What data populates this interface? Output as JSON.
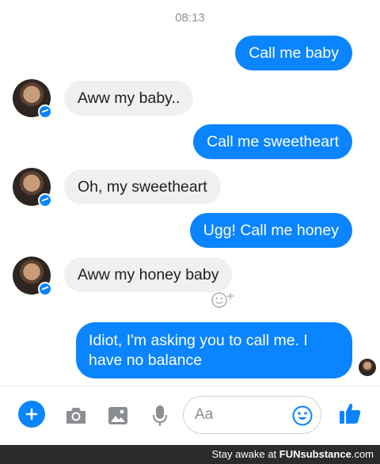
{
  "header": {
    "timestamp": "08:13"
  },
  "messages": [
    {
      "from": "me",
      "text": "Call me baby"
    },
    {
      "from": "contact",
      "text": "Aww my baby.."
    },
    {
      "from": "me",
      "text": "Call me sweetheart"
    },
    {
      "from": "contact",
      "text": "Oh, my sweetheart"
    },
    {
      "from": "me",
      "text": "Ugg! Call me honey"
    },
    {
      "from": "contact",
      "text": "Aww my honey baby"
    },
    {
      "from": "me",
      "text": "Idiot, I'm asking you to call me. I have no balance"
    }
  ],
  "composer": {
    "placeholder": "Aa",
    "icons": [
      "plus-icon",
      "camera-icon",
      "image-icon",
      "microphone-icon",
      "emoji-icon",
      "thumbs-up-icon"
    ]
  },
  "colors": {
    "accent": "#0a84ff",
    "incoming_bubble": "#f1f0f0",
    "footer_bg": "#2b2b2b"
  },
  "watermark": {
    "prefix": "Stay awake at",
    "brand": "FUNsubstance",
    "suffix": ".com"
  }
}
